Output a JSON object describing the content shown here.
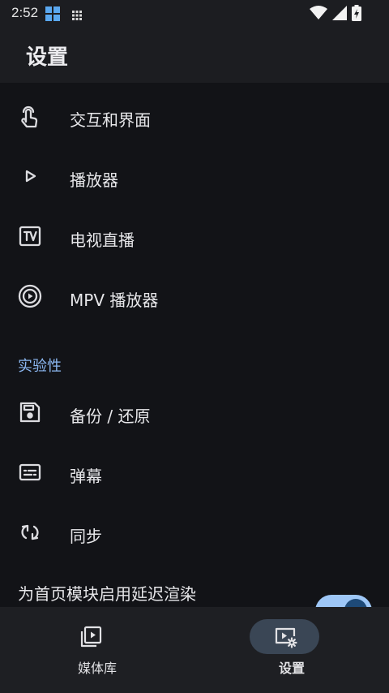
{
  "status_bar": {
    "time": "2:52"
  },
  "app_bar": {
    "title": "设置"
  },
  "settings": {
    "items": [
      {
        "label": "交互和界面",
        "icon": "touch-icon"
      },
      {
        "label": "播放器",
        "icon": "play-icon"
      },
      {
        "label": "电视直播",
        "icon": "tv-icon"
      },
      {
        "label": "MPV 播放器",
        "icon": "mpv-icon"
      }
    ],
    "section_header": "实验性",
    "experimental_items": [
      {
        "label": "备份 / 还原",
        "icon": "save-icon"
      },
      {
        "label": "弹幕",
        "icon": "subtitles-icon"
      },
      {
        "label": "同步",
        "icon": "sync-icon"
      }
    ],
    "toggle": {
      "label": "为首页模块启用延迟渲染",
      "checked": true
    }
  },
  "bottom_nav": {
    "items": [
      {
        "label": "媒体库",
        "icon": "video-library-icon",
        "active": false
      },
      {
        "label": "设置",
        "icon": "video-settings-icon",
        "active": true
      }
    ]
  },
  "colors": {
    "accent": "#8cb8f2",
    "background": "#121317",
    "active_pill": "#3a4655"
  }
}
